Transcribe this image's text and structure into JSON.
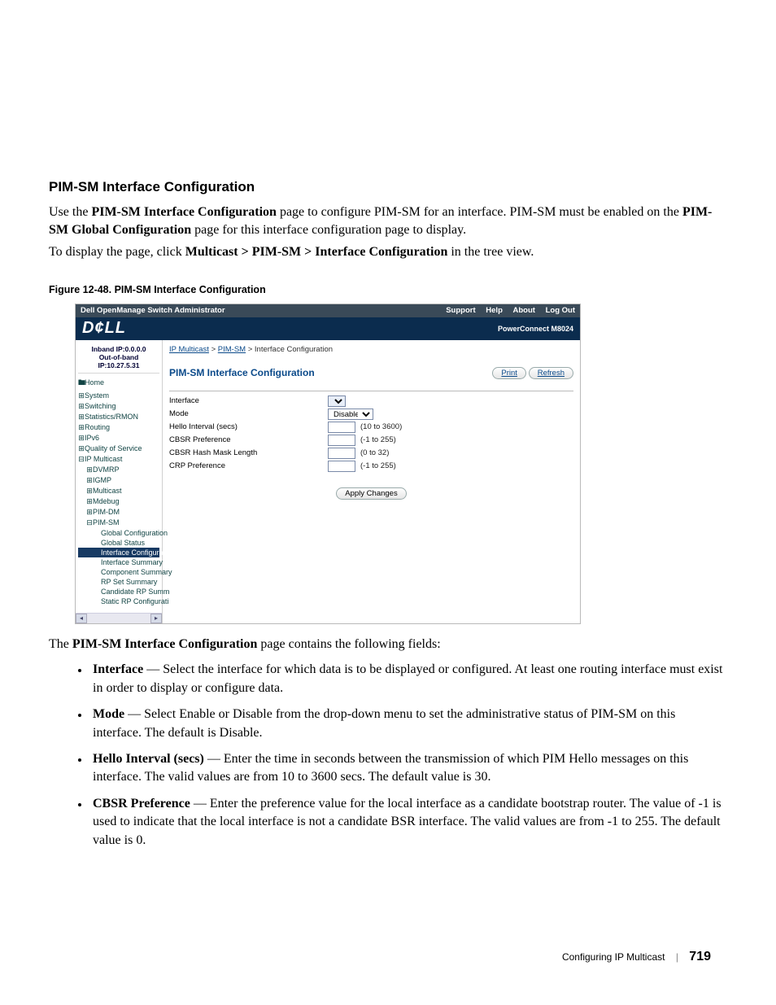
{
  "section": {
    "heading": "PIM-SM Interface Configuration",
    "intro1_a": "Use the ",
    "intro1_b": "PIM-SM Interface Configuration",
    "intro1_c": " page to configure PIM-SM for an interface. PIM-SM must be enabled on the ",
    "intro1_d": "PIM-SM Global Configuration",
    "intro1_e": " page for this interface configuration page to display.",
    "intro2_a": "To display the page, click ",
    "intro2_b": "Multicast > PIM-SM > Interface Configuration",
    "intro2_c": " in the tree view.",
    "figcap": "Figure 12-48.    PIM-SM Interface Configuration"
  },
  "shot": {
    "topbar_left": "Dell OpenManage Switch Administrator",
    "topbar_links": [
      "Support",
      "Help",
      "About",
      "Log Out"
    ],
    "brand": "D¢LL",
    "model": "PowerConnect M8024",
    "ips_line1": "Inband IP:0.0.0.0",
    "ips_line2": "Out-of-band IP:10.27.5.31",
    "nav": {
      "home": "Home",
      "items_top": [
        "System",
        "Switching",
        "Statistics/RMON",
        "Routing",
        "IPv6",
        "Quality of Service"
      ],
      "ipm": "IP Multicast",
      "ipm_children": [
        "DVMRP",
        "IGMP",
        "Multicast",
        "Mdebug",
        "PIM-DM"
      ],
      "pimsm": "PIM-SM",
      "pimsm_children_before": [
        "Global Configuration",
        "Global Status"
      ],
      "pimsm_selected": "Interface Configurat",
      "pimsm_children_after": [
        "Interface Summary",
        "Component Summary",
        "RP Set Summary",
        "Candidate RP Summ",
        "Static RP Configurati"
      ]
    },
    "breadcrumbs": {
      "a": "IP Multicast",
      "b": "PIM-SM",
      "c": "Interface Configuration"
    },
    "page_title": "PIM-SM Interface Configuration",
    "print": "Print",
    "refresh": "Refresh",
    "form": {
      "rows": [
        {
          "label": "Interface",
          "type": "iface"
        },
        {
          "label": "Mode",
          "type": "mode",
          "value": "Disable"
        },
        {
          "label": "Hello Interval (secs)",
          "type": "num",
          "hint": "(10 to 3600)"
        },
        {
          "label": "CBSR Preference",
          "type": "num",
          "hint": "(-1 to 255)"
        },
        {
          "label": "CBSR Hash Mask Length",
          "type": "num",
          "hint": "(0 to 32)"
        },
        {
          "label": "CRP Preference",
          "type": "num",
          "hint": "(-1 to 255)"
        }
      ],
      "apply": "Apply Changes"
    }
  },
  "post": {
    "lead_a": "The ",
    "lead_b": "PIM-SM Interface Configuration",
    "lead_c": " page contains the following fields:",
    "bullets": [
      {
        "t": "Interface",
        "d": " — Select the interface for which data is to be displayed or configured. At least one routing interface must exist in order to display or configure data."
      },
      {
        "t": "Mode",
        "d": " — Select Enable or Disable from the drop-down menu to set the administrative status of PIM-SM on this interface. The default is Disable."
      },
      {
        "t": "Hello Interval (secs)",
        "d": " — Enter the time in seconds between the transmission of which PIM Hello messages on this interface. The valid values are from 10 to 3600 secs. The default value is 30."
      },
      {
        "t": "CBSR Preference",
        "d": " — Enter the preference value for the local interface as a candidate bootstrap router. The value of -1 is used to indicate that the local interface is not a candidate BSR interface. The valid values are from -1 to 255. The default value is 0."
      }
    ]
  },
  "footer": {
    "chapter": "Configuring IP Multicast",
    "page": "719"
  }
}
